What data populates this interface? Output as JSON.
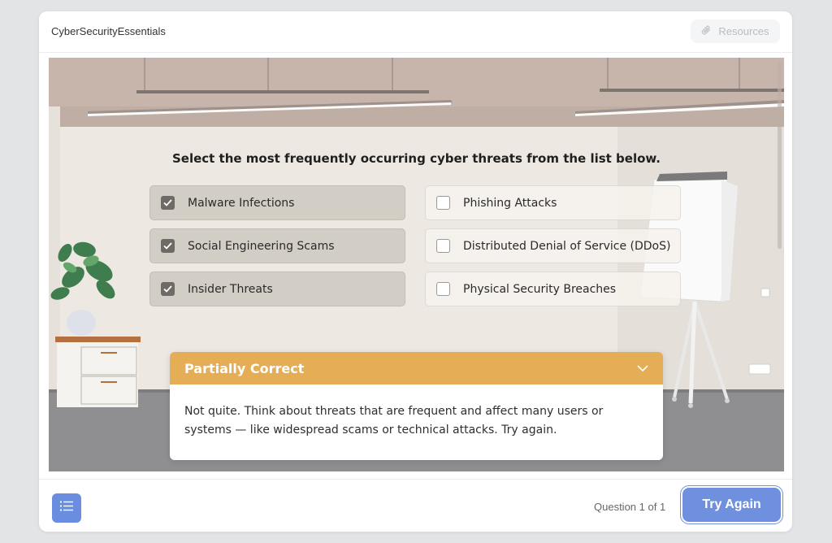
{
  "header": {
    "course_title": "CyberSecurityEssentials",
    "resources_label": "Resources",
    "resources_icon": "paperclip-icon"
  },
  "question": {
    "prompt": "Select the most frequently occurring cyber threats from the list below.",
    "options": [
      {
        "label": "Malware Infections",
        "checked": true
      },
      {
        "label": "Phishing Attacks",
        "checked": false
      },
      {
        "label": "Social Engineering Scams",
        "checked": true
      },
      {
        "label": "Distributed Denial of Service (DDoS)",
        "checked": false
      },
      {
        "label": "Insider Threats",
        "checked": true
      },
      {
        "label": "Physical Security Breaches",
        "checked": false
      }
    ]
  },
  "feedback": {
    "title": "Partially Correct",
    "message": "Not quite. Think about threats that are frequent and affect many users or systems — like widespread scams or technical attacks. Try again.",
    "accent_color": "#e5ad56",
    "toggle_icon": "chevron-down-icon"
  },
  "footer": {
    "menu_icon": "list-icon",
    "question_counter": "Question 1 of 1",
    "try_again_label": "Try Again",
    "button_color": "#6f8fdf"
  }
}
